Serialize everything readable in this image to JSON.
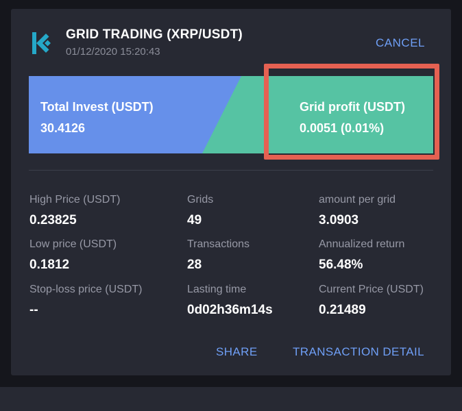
{
  "header": {
    "title": "GRID TRADING (XRP/USDT)",
    "timestamp": "01/12/2020 15:20:43",
    "cancel_label": "CANCEL",
    "logo_icon": "kucoin-logo-icon"
  },
  "summary": {
    "total_invest_label": "Total Invest (USDT)",
    "total_invest_value": "30.4126",
    "grid_profit_label": "Grid profit (USDT)",
    "grid_profit_value": "0.0051 (0.01%)"
  },
  "stats": {
    "col1": [
      {
        "label": "High Price (USDT)",
        "value": "0.23825"
      },
      {
        "label": "Low price (USDT)",
        "value": "0.1812"
      },
      {
        "label": "Stop-loss price (USDT)",
        "value": "--"
      }
    ],
    "col2": [
      {
        "label": "Grids",
        "value": "49"
      },
      {
        "label": "Transactions",
        "value": "28"
      },
      {
        "label": "Lasting time",
        "value": "0d02h36m14s"
      }
    ],
    "col3": [
      {
        "label": "amount per grid",
        "value": "3.0903"
      },
      {
        "label": "Annualized return",
        "value": "56.48%"
      },
      {
        "label": "Current Price (USDT)",
        "value": "0.21489"
      }
    ]
  },
  "actions": {
    "share_label": "SHARE",
    "detail_label": "TRANSACTION DETAIL"
  },
  "colors": {
    "card_bg": "#272933",
    "invest_blue": "#6690ea",
    "profit_green": "#56c3a3",
    "highlight_red": "#e56152",
    "link_blue": "#6f9ff6"
  }
}
